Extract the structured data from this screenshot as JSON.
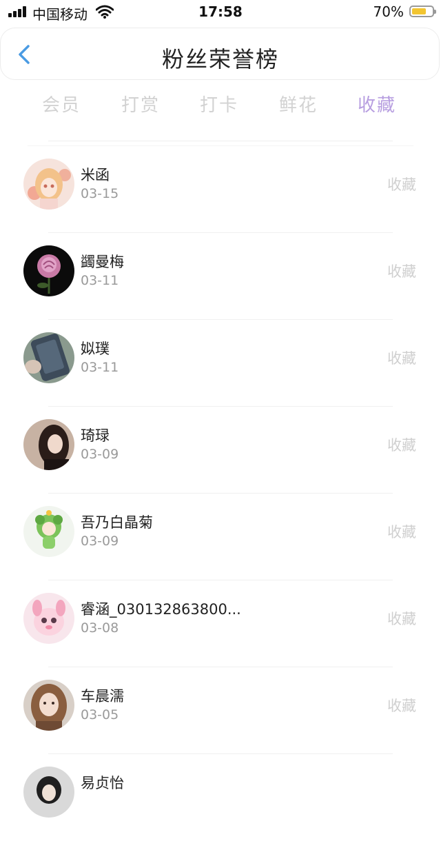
{
  "status_bar": {
    "carrier": "中国移动",
    "time": "17:58",
    "battery": "70%",
    "battery_level": 0.7
  },
  "header": {
    "title": "粉丝荣誉榜",
    "back_icon": "chevron-left-icon"
  },
  "tabs": [
    {
      "label": "会员",
      "active": false
    },
    {
      "label": "打赏",
      "active": false
    },
    {
      "label": "打卡",
      "active": false
    },
    {
      "label": "鲜花",
      "active": false
    },
    {
      "label": "收藏",
      "active": true
    }
  ],
  "colors": {
    "accent": "#b79ee0",
    "back": "#4a9be3",
    "inactive_tab": "#d2d2d2",
    "muted_action": "#cfcfcf"
  },
  "fans": [
    {
      "name": "米函",
      "date": "03-15",
      "action": "收藏"
    },
    {
      "name": "蠲曼梅",
      "date": "03-11",
      "action": "收藏"
    },
    {
      "name": "姒璞",
      "date": "03-11",
      "action": "收藏"
    },
    {
      "name": "琦琭",
      "date": "03-09",
      "action": "收藏"
    },
    {
      "name": "吾乃白晶菊",
      "date": "03-09",
      "action": "收藏"
    },
    {
      "name": "睿涵_030132863800...",
      "date": "03-08",
      "action": "收藏"
    },
    {
      "name": "车晨濡",
      "date": "03-05",
      "action": "收藏"
    },
    {
      "name": "易贞怡",
      "date": "",
      "action": ""
    }
  ]
}
